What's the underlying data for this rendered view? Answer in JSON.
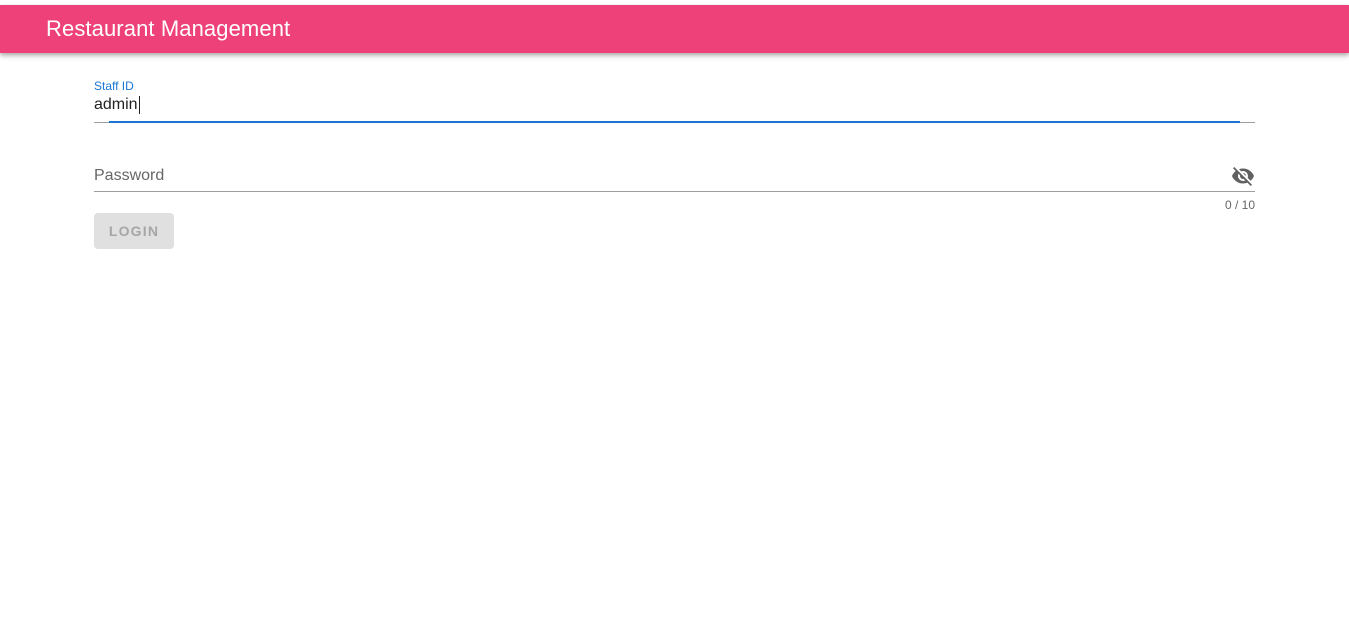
{
  "app_bar": {
    "title": "Restaurant Management",
    "color": "#ee417a"
  },
  "form": {
    "staff_id": {
      "label": "Staff ID",
      "value": "admin",
      "focused": true,
      "accent_color": "#1976d2"
    },
    "password": {
      "label": "Password",
      "value": "",
      "icon": "eye-off-icon",
      "counter": "0 / 10"
    },
    "login_button": {
      "label": "LOGIN",
      "disabled": true
    }
  }
}
